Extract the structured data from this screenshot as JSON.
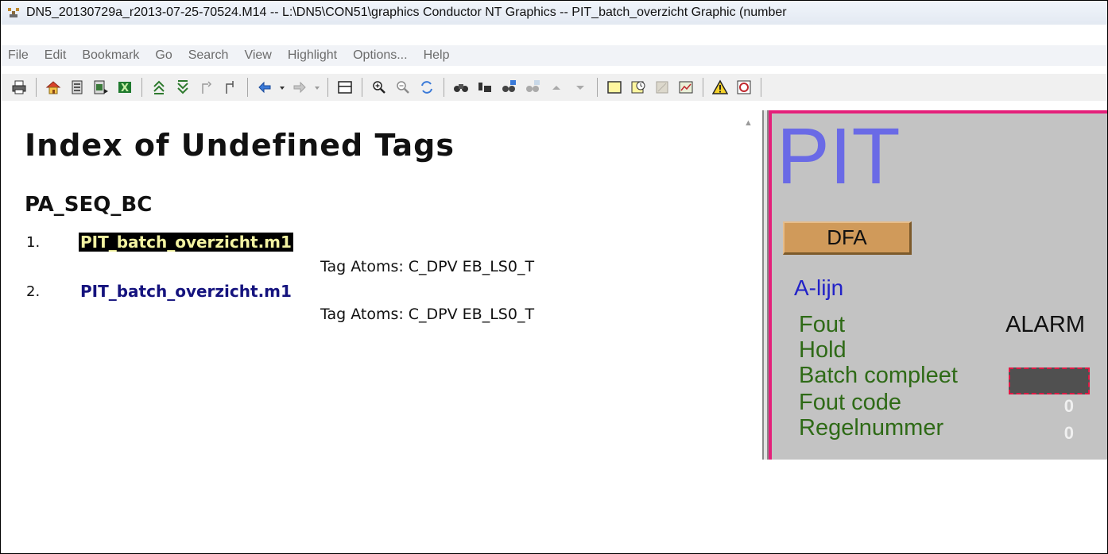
{
  "window": {
    "title": "DN5_20130729a_r2013-07-25-70524.M14 -- L:\\DN5\\CON51\\graphics Conductor NT Graphics -- PIT_batch_overzicht Graphic (number"
  },
  "menu": {
    "items": [
      "File",
      "Edit",
      "Bookmark",
      "Go",
      "Search",
      "View",
      "Highlight",
      "Options...",
      "Help"
    ]
  },
  "toolbar": {
    "icons": [
      "print-icon",
      "home-icon",
      "page-icon",
      "page-export-icon",
      "excel-icon",
      "collapse-all-icon",
      "expand-all-icon",
      "tree-up-icon",
      "tree-down-icon",
      "back-icon",
      "forward-icon",
      "panel-icon",
      "zoom-in-icon",
      "zoom-out-icon",
      "refresh-icon",
      "find-icon",
      "find-next-icon",
      "find-tag-icon",
      "find-tag-disabled-icon",
      "up-arrow-icon",
      "down-arrow-icon",
      "note-icon",
      "history-icon",
      "disabled-icon",
      "graph-icon",
      "warning-icon",
      "alarm-icon"
    ]
  },
  "index": {
    "heading": "Index of Undefined Tags",
    "section": "PA_SEQ_BC",
    "items": [
      {
        "number": "1.",
        "tag": "PIT_batch_overzicht.m1",
        "atoms": "Tag Atoms: C_DPV EB_LS0_T",
        "selected": true
      },
      {
        "number": "2.",
        "tag": "PIT_batch_overzicht.m1",
        "atoms": "Tag Atoms: C_DPV EB_LS0_T",
        "selected": false
      }
    ]
  },
  "graphic": {
    "title": "PIT",
    "dfa_button": "DFA",
    "line_label": "A-lijn",
    "fout_label": "Fout",
    "alarm_status": "ALARM",
    "hold_label": "Hold",
    "batch_compleet_label": "Batch compleet",
    "fout_code_label": "Fout code",
    "fout_code_value": "0",
    "regelnummer_label": "Regelnummer",
    "regelnummer_value": "0",
    "colors": {
      "title": "#6a6ae6",
      "border": "#e4207a",
      "labels": "#2e6a16",
      "line_label": "#2222c8",
      "background": "#c3c3c3"
    }
  }
}
